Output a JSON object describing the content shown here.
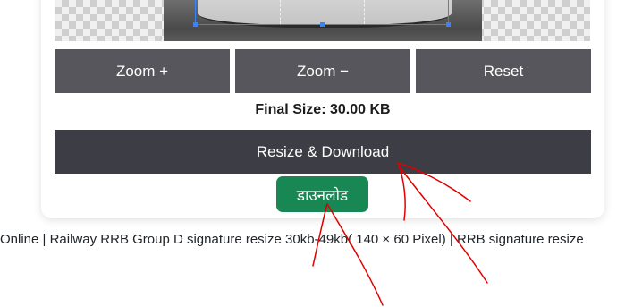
{
  "crop_buttons": {
    "zoom_in": "Zoom +",
    "zoom_out": "Zoom −",
    "reset": "Reset"
  },
  "final_size": "Final Size: 30.00 KB",
  "resize_button": "Resize & Download",
  "download_button": "डाउनलोड",
  "caption": "Online | Railway RRB Group D signature resize 30kb-49kb( 140 × 60 Pixel) | RRB signature resize",
  "colors": {
    "button_gray": "#56565c",
    "resize_dark": "#3d3d45",
    "download_green": "#198754",
    "crop_selection": "#3b82f6",
    "annotation_red": "#e00000"
  }
}
